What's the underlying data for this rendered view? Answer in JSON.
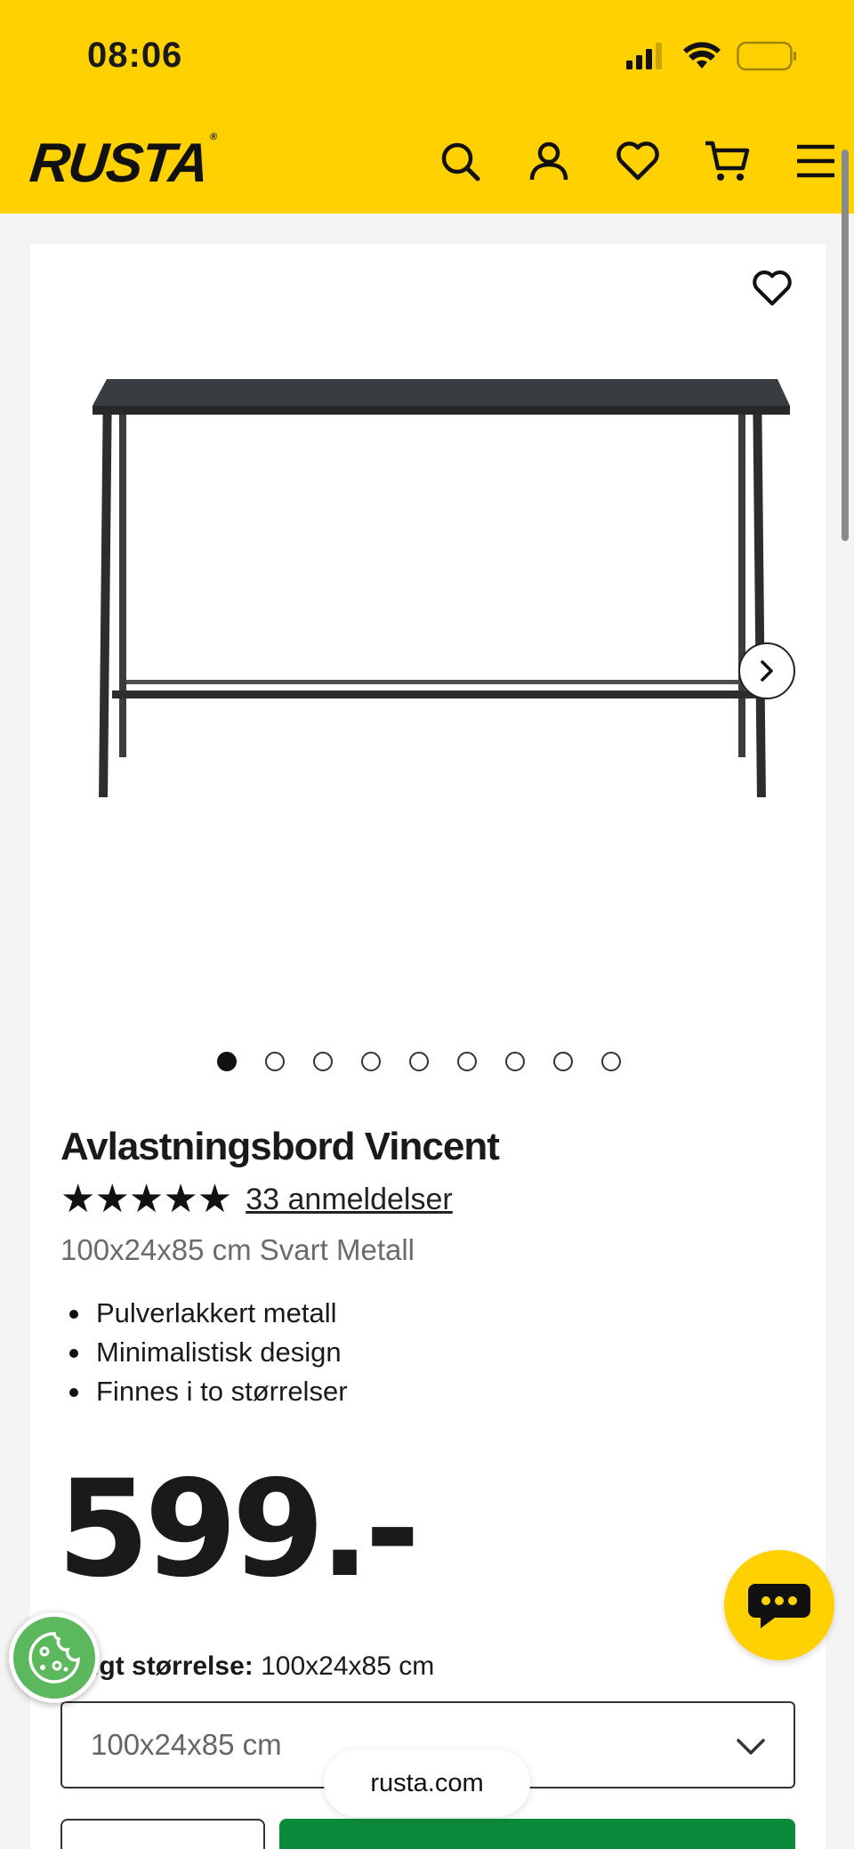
{
  "status_bar": {
    "time": "08:06",
    "icons": [
      "signal-icon",
      "wifi-icon",
      "battery-icon"
    ]
  },
  "header": {
    "logo": "RUSTA",
    "icons": [
      "search-icon",
      "account-icon",
      "wishlist-icon",
      "cart-icon",
      "menu-icon"
    ]
  },
  "gallery": {
    "image_alt_subject": "black metal console table",
    "dot_count": 9,
    "active_index": 0
  },
  "product": {
    "title": "Avlastningsbord Vincent",
    "stars": "★★★★★",
    "reviews_link": "33 anmeldelser",
    "subtitle": "100x24x85 cm Svart Metall",
    "features": [
      "Pulverlakkert metall",
      "Minimalistisk design",
      "Finnes i to størrelser"
    ],
    "price": "599.-"
  },
  "size": {
    "label_bold": "Valgt størrelse:",
    "label_value": "100x24x85 cm",
    "select_value": "100x24x85 cm"
  },
  "browser": {
    "url": "rusta.com"
  },
  "colors": {
    "brand_yellow": "#ffd100",
    "primary_green": "#0c8a3c",
    "cookie_green": "#5cb85c"
  }
}
